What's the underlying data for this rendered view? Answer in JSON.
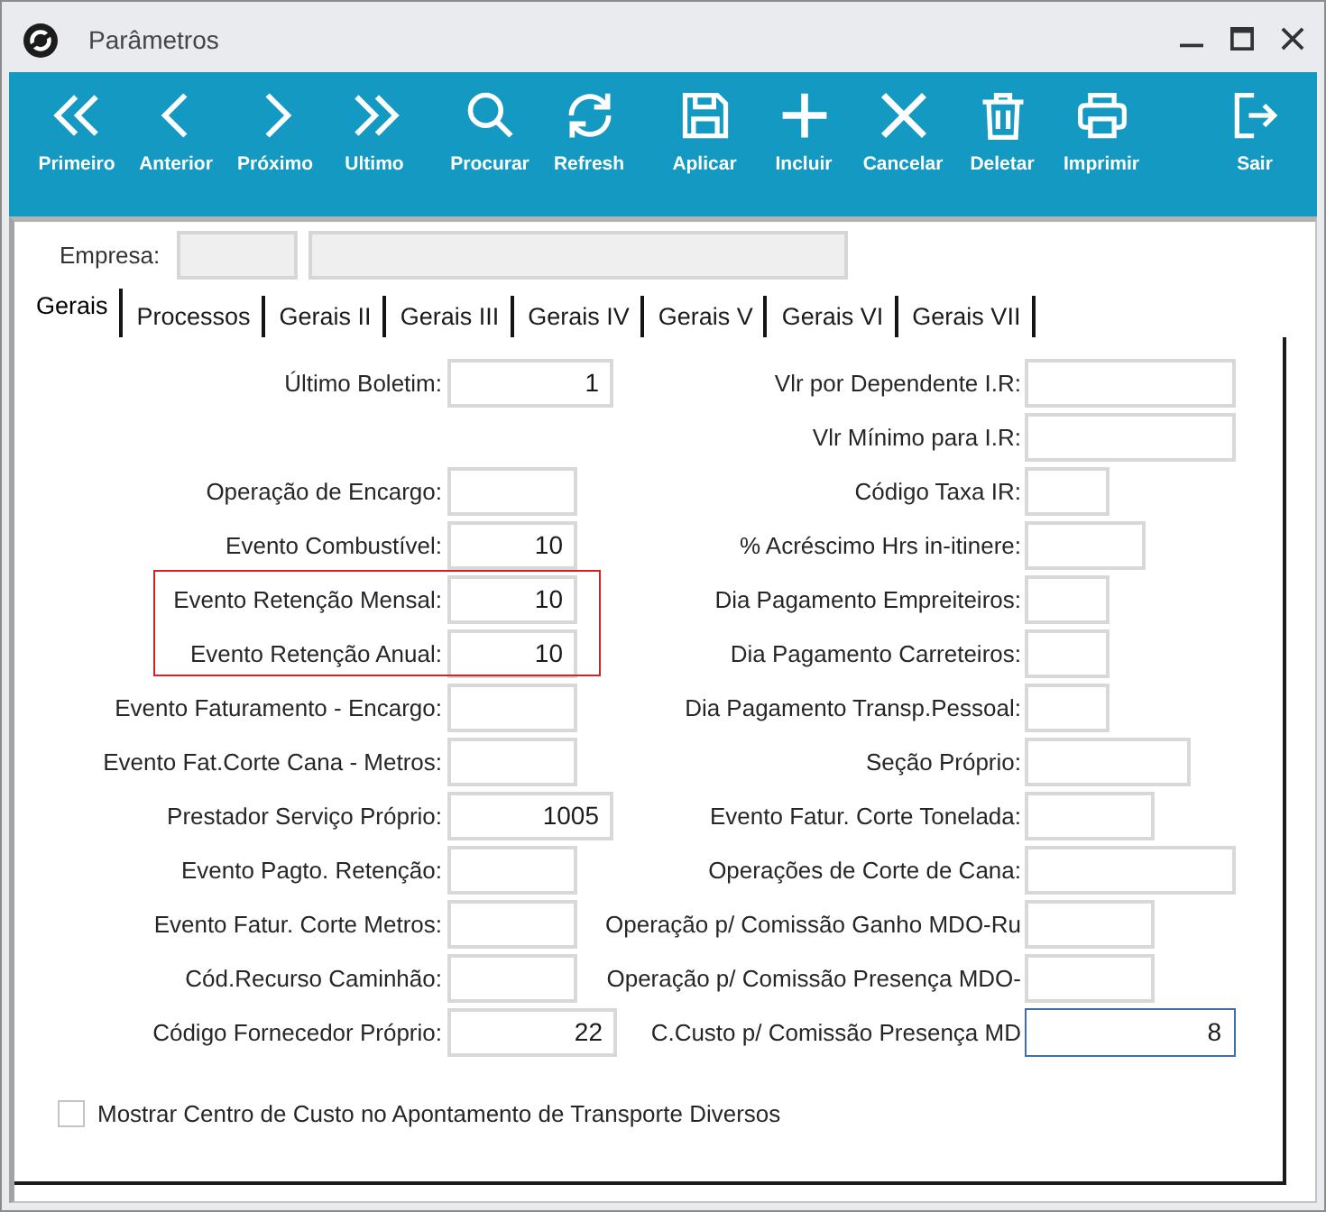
{
  "window": {
    "title": "Parâmetros"
  },
  "toolbar": {
    "groups": [
      [
        {
          "label": "Primeiro"
        },
        {
          "label": "Anterior"
        },
        {
          "label": "Próximo"
        },
        {
          "label": "Ultimo"
        }
      ],
      [
        {
          "label": "Procurar"
        },
        {
          "label": "Refresh"
        }
      ],
      [
        {
          "label": "Aplicar"
        },
        {
          "label": "Incluir"
        },
        {
          "label": "Cancelar"
        },
        {
          "label": "Deletar"
        },
        {
          "label": "Imprimir"
        }
      ],
      [
        {
          "label": "Sair"
        }
      ]
    ]
  },
  "company": {
    "label": "Empresa:",
    "fields": [
      {
        "disabled": true
      },
      {
        "disabled": true
      }
    ]
  },
  "tabs": [
    {
      "label": "Gerais",
      "selected": true
    },
    {
      "label": "Processos",
      "selected": false
    },
    {
      "label": "Gerais II",
      "selected": false
    },
    {
      "label": "Gerais III",
      "selected": false
    },
    {
      "label": "Gerais IV",
      "selected": false
    },
    {
      "label": "Gerais V",
      "selected": false
    },
    {
      "label": "Gerais VI",
      "selected": false
    },
    {
      "label": "Gerais VII",
      "selected": false
    }
  ],
  "form": {
    "rows": [
      {
        "left": {
          "label": "Último Boletim:",
          "value": "1",
          "focused": false,
          "highlighted": false
        },
        "right": {
          "label": "Vlr por Dependente I.R:",
          "focused": false
        }
      },
      {
        "right": {
          "label": "Vlr Mínimo para I.R:",
          "focused": false
        }
      },
      {
        "left": {
          "label": "Operação de Encargo:",
          "focused": false,
          "highlighted": false
        },
        "right": {
          "label": "Código Taxa IR:",
          "focused": false
        }
      },
      {
        "left": {
          "label": "Evento Combustível:",
          "value": "10",
          "focused": false,
          "highlighted": false
        },
        "right": {
          "label": "% Acréscimo Hrs in-itinere:",
          "focused": false
        }
      },
      {
        "left": {
          "label": "Evento Retenção Mensal:",
          "value": "10",
          "focused": false,
          "highlighted": true
        },
        "right": {
          "label": "Dia Pagamento Empreiteiros:",
          "focused": false
        }
      },
      {
        "left": {
          "label": "Evento Retenção Anual:",
          "value": "10",
          "focused": false,
          "highlighted": true
        },
        "right": {
          "label": "Dia Pagamento Carreteiros:",
          "focused": false
        }
      },
      {
        "left": {
          "label": "Evento Faturamento - Encargo:",
          "focused": false,
          "highlighted": false
        },
        "right": {
          "label": "Dia Pagamento Transp.Pessoal:",
          "focused": false
        }
      },
      {
        "left": {
          "label": "Evento Fat.Corte Cana - Metros:",
          "focused": false,
          "highlighted": false
        },
        "right": {
          "label": "Seção Próprio:",
          "focused": false
        }
      },
      {
        "left": {
          "label": "Prestador Serviço Próprio:",
          "value": "1005",
          "focused": false,
          "highlighted": false
        },
        "right": {
          "label": "Evento Fatur. Corte Tonelada:",
          "focused": false
        }
      },
      {
        "left": {
          "label": "Evento Pagto. Retenção:",
          "focused": false,
          "highlighted": false
        },
        "right": {
          "label": "Operações de Corte de Cana:",
          "focused": false
        }
      },
      {
        "left": {
          "label": "Evento Fatur. Corte Metros:",
          "focused": false,
          "highlighted": false
        },
        "right": {
          "label": "Operação p/ Comissão Ganho MDO-Ru",
          "focused": false
        }
      },
      {
        "left": {
          "label": "Cód.Recurso Caminhão:",
          "focused": false,
          "highlighted": false
        },
        "right": {
          "label": "Operação p/ Comissão Presença MDO-",
          "focused": false
        }
      },
      {
        "left": {
          "label": "Código Fornecedor Próprio:",
          "value": "22",
          "focused": false,
          "highlighted": false
        },
        "right": {
          "label": "C.Custo p/ Comissão Presença MD",
          "value": "8",
          "focused": true
        }
      }
    ]
  },
  "checkbox": {
    "label": "Mostrar Centro de Custo no Apontamento de Transporte Diversos",
    "checked": false
  }
}
